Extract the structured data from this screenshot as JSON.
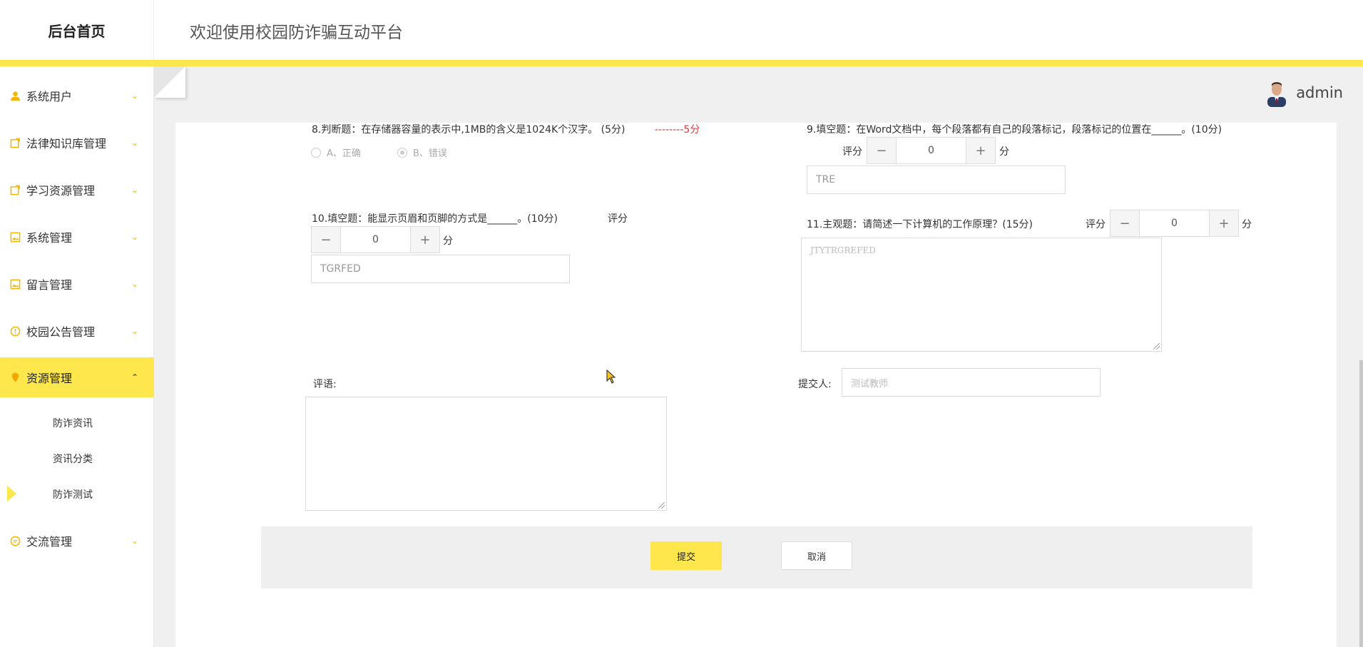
{
  "header": {
    "brand": "后台首页",
    "title": "欢迎使用校园防诈骗互动平台"
  },
  "user": {
    "name": "admin"
  },
  "sidebar": {
    "items": [
      {
        "label": "系统用户",
        "icon": "user-icon"
      },
      {
        "label": "法律知识库管理",
        "icon": "edit-icon"
      },
      {
        "label": "学习资源管理",
        "icon": "edit-icon"
      },
      {
        "label": "系统管理",
        "icon": "image-icon"
      },
      {
        "label": "留言管理",
        "icon": "image-icon"
      },
      {
        "label": "校园公告管理",
        "icon": "alert-icon"
      },
      {
        "label": "资源管理",
        "icon": "location-pin-icon",
        "active": true
      },
      {
        "label": "交流管理",
        "icon": "chat-icon"
      }
    ],
    "subitems": [
      {
        "label": "防诈资讯"
      },
      {
        "label": "资讯分类"
      },
      {
        "label": "防诈测试",
        "active": true
      }
    ]
  },
  "form": {
    "q8": {
      "text": "8.判断题：在存储器容量的表示中,1MB的含义是1024K个汉字。 (5分)",
      "score_text": "--------5分",
      "option_a": "A、正确",
      "option_b": "B、错误"
    },
    "q9": {
      "text": "9.填空题：在Word文档中，每个段落都有自己的段落标记，段落标记的位置在______。(10分)",
      "score_label": "评分",
      "score_value": "0",
      "unit": "分",
      "answer": "TRE"
    },
    "q10": {
      "text": "10.填空题：能显示页眉和页脚的方式是______。(10分)",
      "score_label": "评分",
      "score_value": "0",
      "unit": "分",
      "answer": "TGRFED"
    },
    "q11": {
      "text": "11.主观题：请简述一下计算机的工作原理？(15分)",
      "score_label": "评分",
      "score_value": "0",
      "unit": "分",
      "answer": "JTYTRGREFED"
    },
    "comment_label": "评语:",
    "comment_value": "",
    "submitter_label": "提交人:",
    "submitter_value": "测试教师",
    "stepper_minus": "−",
    "stepper_plus": "+"
  },
  "actions": {
    "submit": "提交",
    "cancel": "取消"
  },
  "colors": {
    "accent": "#fde74c",
    "score_red": "#e23b3b"
  }
}
